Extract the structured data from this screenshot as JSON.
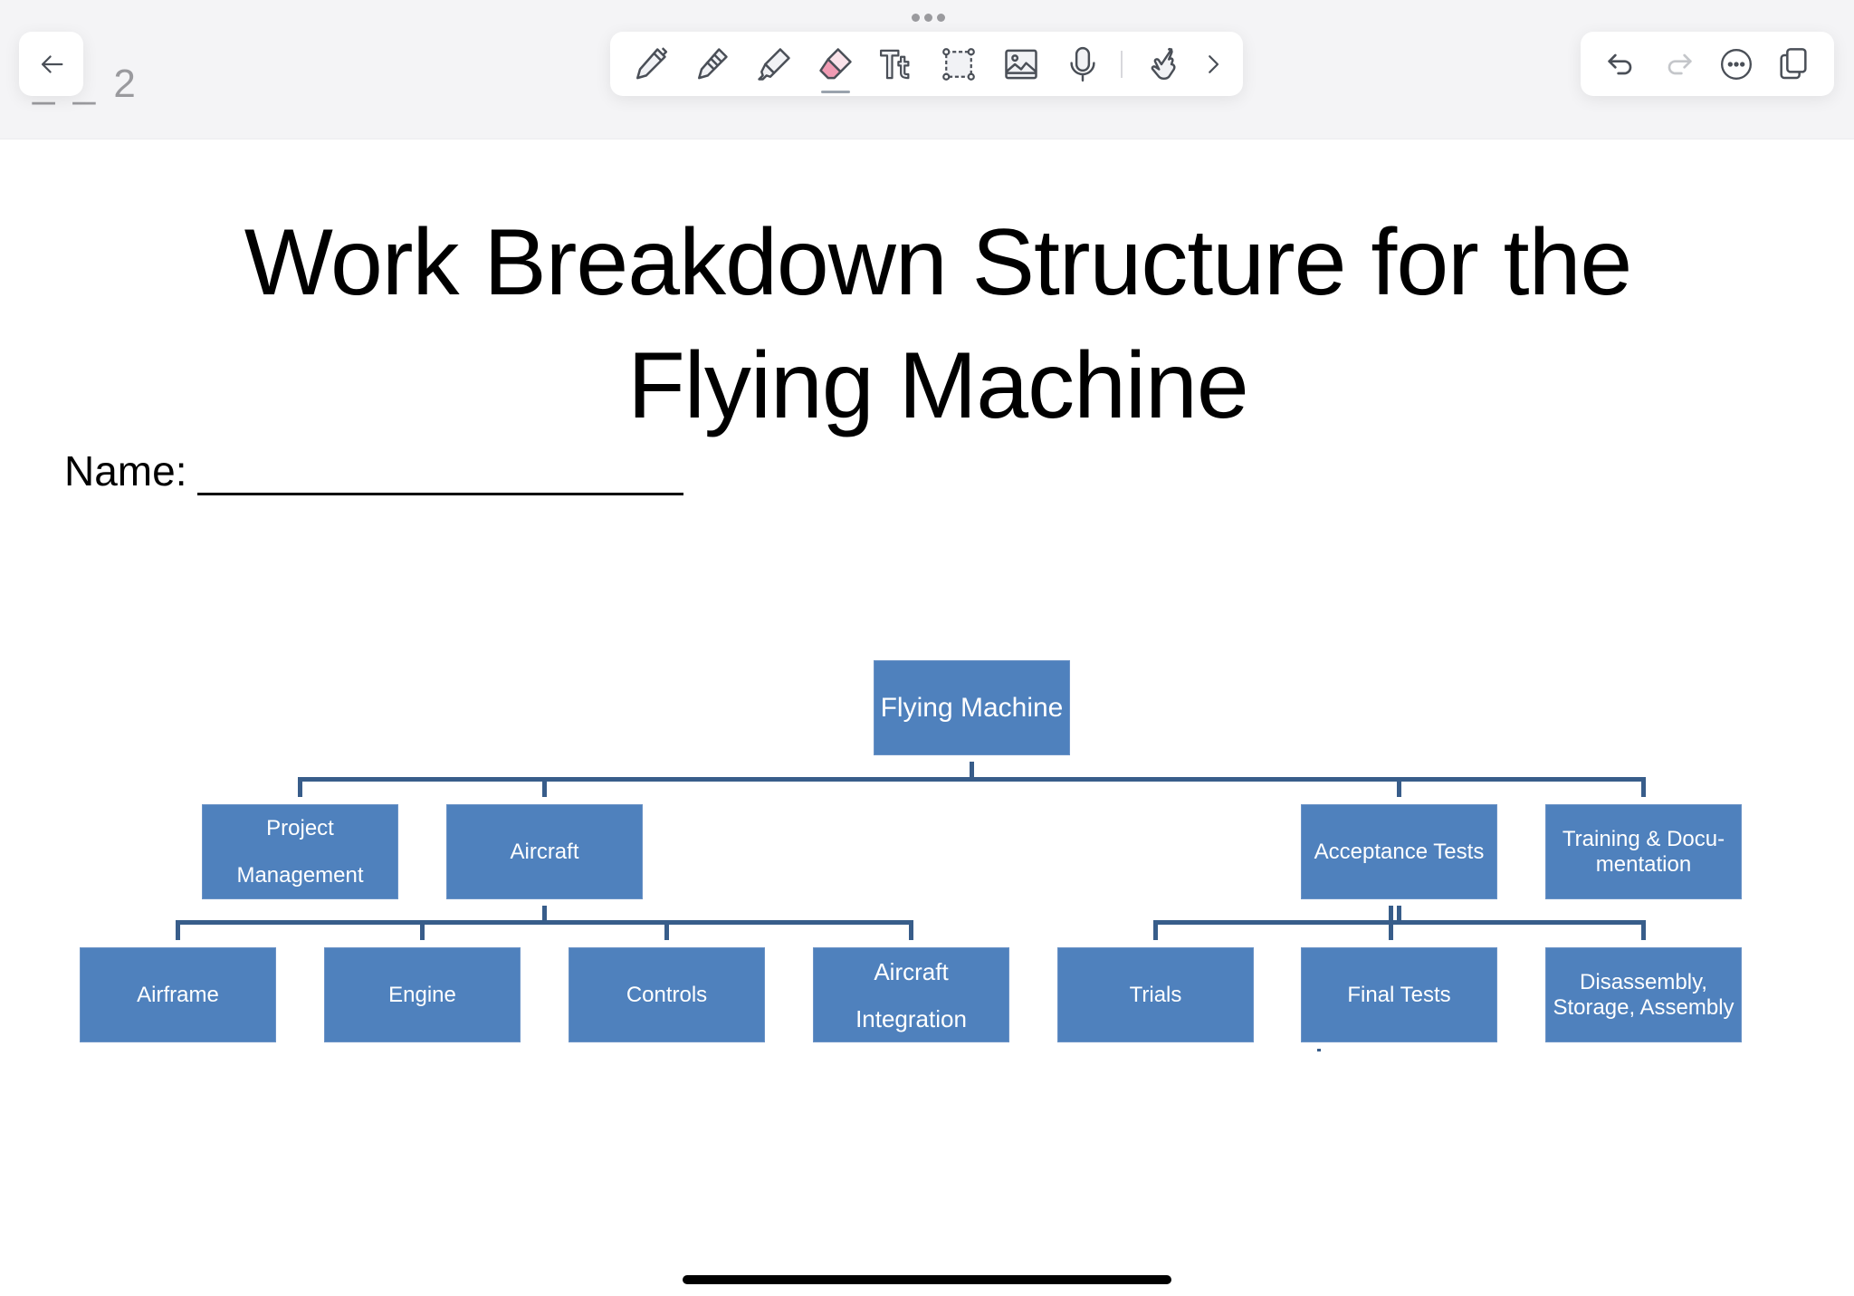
{
  "app": {
    "page_indicator": "2",
    "toolbar": {
      "tools": [
        {
          "id": "pen",
          "icon": "pen-icon"
        },
        {
          "id": "pencil",
          "icon": "pencil-icon"
        },
        {
          "id": "highlighter",
          "icon": "highlighter-icon"
        },
        {
          "id": "eraser",
          "icon": "eraser-icon",
          "active": true
        },
        {
          "id": "text",
          "icon": "text-tool-icon"
        },
        {
          "id": "lasso",
          "icon": "lasso-select-icon"
        },
        {
          "id": "image",
          "icon": "image-icon"
        },
        {
          "id": "audio",
          "icon": "microphone-icon"
        },
        {
          "id": "touch",
          "icon": "hand-touch-icon"
        },
        {
          "id": "more-tools",
          "icon": "chevron-right-icon"
        }
      ],
      "right": [
        {
          "id": "undo",
          "icon": "undo-icon",
          "enabled": true
        },
        {
          "id": "redo",
          "icon": "redo-icon",
          "enabled": false
        },
        {
          "id": "more",
          "icon": "more-icon"
        },
        {
          "id": "pages",
          "icon": "pages-icon"
        }
      ]
    }
  },
  "document": {
    "title_line1": "Work Breakdown Structure for the",
    "title_line2": "Flying Machine",
    "name_label": "Name:"
  },
  "wbs": {
    "root": "Flying Machine",
    "level1": [
      "Project\nManagement",
      "Aircraft",
      "Acceptance Tests",
      "Training & Docu-\nmentation"
    ],
    "aircraft_children": [
      "Airframe",
      "Engine",
      "Controls",
      "Aircraft\nIntegration"
    ],
    "acceptance_children": [
      "Trials",
      "Final Tests",
      "Disassembly,\nStorage, Assembly"
    ]
  },
  "colors": {
    "box_fill": "#4f81bd",
    "connector": "#385d8a",
    "topbar_bg": "#f4f4f6",
    "icon_stroke": "#4a4f57",
    "eraser_pink": "#f09bb3"
  }
}
